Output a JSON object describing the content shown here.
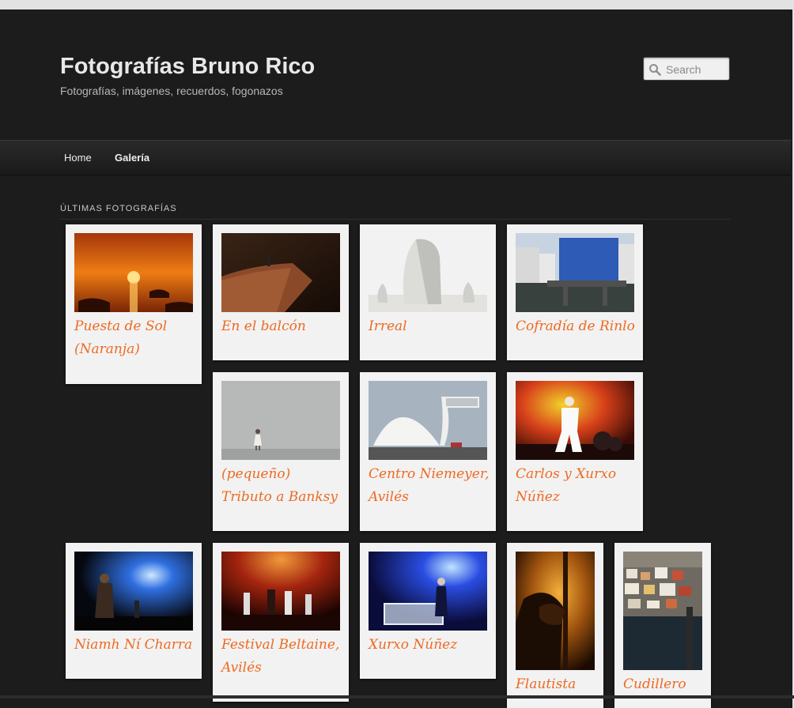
{
  "site": {
    "title": "Fotografías Bruno Rico",
    "description": "Fotografías, imágenes, recuerdos, fogonazos"
  },
  "search": {
    "placeholder": "Search",
    "icon": "magnifier-icon"
  },
  "nav": {
    "items": [
      {
        "label": "Home"
      },
      {
        "label": "Galería"
      }
    ]
  },
  "section": {
    "title": "ÚLTIMAS FOTOGRAFÍAS"
  },
  "photos": [
    {
      "caption": "Puesta de Sol (Naranja)"
    },
    {
      "caption": "En el balcón"
    },
    {
      "caption": "Irreal"
    },
    {
      "caption": "Cofradía de Rinlo"
    },
    {
      "caption": "(pequeño) Tributo a Banksy"
    },
    {
      "caption": "Centro Niemeyer, Avilés"
    },
    {
      "caption": "Carlos y Xurxo Núñez"
    },
    {
      "caption": "Niamh Ní Charra"
    },
    {
      "caption": "Festival Beltaine, Avilés"
    },
    {
      "caption": "Xurxo Núñez"
    },
    {
      "caption": "Flautista"
    },
    {
      "caption": "Cudillero"
    }
  ],
  "colors": {
    "caption": "#ee6a22",
    "card": "#f2f2f2",
    "page": "#1c1c1c"
  }
}
